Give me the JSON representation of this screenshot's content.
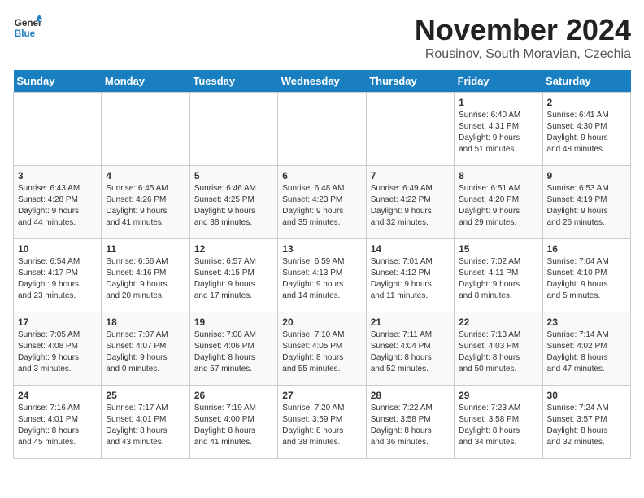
{
  "header": {
    "logo_general": "General",
    "logo_blue": "Blue",
    "month_title": "November 2024",
    "location": "Rousinov, South Moravian, Czechia"
  },
  "weekdays": [
    "Sunday",
    "Monday",
    "Tuesday",
    "Wednesday",
    "Thursday",
    "Friday",
    "Saturday"
  ],
  "weeks": [
    [
      {
        "day": "",
        "info": ""
      },
      {
        "day": "",
        "info": ""
      },
      {
        "day": "",
        "info": ""
      },
      {
        "day": "",
        "info": ""
      },
      {
        "day": "",
        "info": ""
      },
      {
        "day": "1",
        "info": "Sunrise: 6:40 AM\nSunset: 4:31 PM\nDaylight: 9 hours\nand 51 minutes."
      },
      {
        "day": "2",
        "info": "Sunrise: 6:41 AM\nSunset: 4:30 PM\nDaylight: 9 hours\nand 48 minutes."
      }
    ],
    [
      {
        "day": "3",
        "info": "Sunrise: 6:43 AM\nSunset: 4:28 PM\nDaylight: 9 hours\nand 44 minutes."
      },
      {
        "day": "4",
        "info": "Sunrise: 6:45 AM\nSunset: 4:26 PM\nDaylight: 9 hours\nand 41 minutes."
      },
      {
        "day": "5",
        "info": "Sunrise: 6:46 AM\nSunset: 4:25 PM\nDaylight: 9 hours\nand 38 minutes."
      },
      {
        "day": "6",
        "info": "Sunrise: 6:48 AM\nSunset: 4:23 PM\nDaylight: 9 hours\nand 35 minutes."
      },
      {
        "day": "7",
        "info": "Sunrise: 6:49 AM\nSunset: 4:22 PM\nDaylight: 9 hours\nand 32 minutes."
      },
      {
        "day": "8",
        "info": "Sunrise: 6:51 AM\nSunset: 4:20 PM\nDaylight: 9 hours\nand 29 minutes."
      },
      {
        "day": "9",
        "info": "Sunrise: 6:53 AM\nSunset: 4:19 PM\nDaylight: 9 hours\nand 26 minutes."
      }
    ],
    [
      {
        "day": "10",
        "info": "Sunrise: 6:54 AM\nSunset: 4:17 PM\nDaylight: 9 hours\nand 23 minutes."
      },
      {
        "day": "11",
        "info": "Sunrise: 6:56 AM\nSunset: 4:16 PM\nDaylight: 9 hours\nand 20 minutes."
      },
      {
        "day": "12",
        "info": "Sunrise: 6:57 AM\nSunset: 4:15 PM\nDaylight: 9 hours\nand 17 minutes."
      },
      {
        "day": "13",
        "info": "Sunrise: 6:59 AM\nSunset: 4:13 PM\nDaylight: 9 hours\nand 14 minutes."
      },
      {
        "day": "14",
        "info": "Sunrise: 7:01 AM\nSunset: 4:12 PM\nDaylight: 9 hours\nand 11 minutes."
      },
      {
        "day": "15",
        "info": "Sunrise: 7:02 AM\nSunset: 4:11 PM\nDaylight: 9 hours\nand 8 minutes."
      },
      {
        "day": "16",
        "info": "Sunrise: 7:04 AM\nSunset: 4:10 PM\nDaylight: 9 hours\nand 5 minutes."
      }
    ],
    [
      {
        "day": "17",
        "info": "Sunrise: 7:05 AM\nSunset: 4:08 PM\nDaylight: 9 hours\nand 3 minutes."
      },
      {
        "day": "18",
        "info": "Sunrise: 7:07 AM\nSunset: 4:07 PM\nDaylight: 9 hours\nand 0 minutes."
      },
      {
        "day": "19",
        "info": "Sunrise: 7:08 AM\nSunset: 4:06 PM\nDaylight: 8 hours\nand 57 minutes."
      },
      {
        "day": "20",
        "info": "Sunrise: 7:10 AM\nSunset: 4:05 PM\nDaylight: 8 hours\nand 55 minutes."
      },
      {
        "day": "21",
        "info": "Sunrise: 7:11 AM\nSunset: 4:04 PM\nDaylight: 8 hours\nand 52 minutes."
      },
      {
        "day": "22",
        "info": "Sunrise: 7:13 AM\nSunset: 4:03 PM\nDaylight: 8 hours\nand 50 minutes."
      },
      {
        "day": "23",
        "info": "Sunrise: 7:14 AM\nSunset: 4:02 PM\nDaylight: 8 hours\nand 47 minutes."
      }
    ],
    [
      {
        "day": "24",
        "info": "Sunrise: 7:16 AM\nSunset: 4:01 PM\nDaylight: 8 hours\nand 45 minutes."
      },
      {
        "day": "25",
        "info": "Sunrise: 7:17 AM\nSunset: 4:01 PM\nDaylight: 8 hours\nand 43 minutes."
      },
      {
        "day": "26",
        "info": "Sunrise: 7:19 AM\nSunset: 4:00 PM\nDaylight: 8 hours\nand 41 minutes."
      },
      {
        "day": "27",
        "info": "Sunrise: 7:20 AM\nSunset: 3:59 PM\nDaylight: 8 hours\nand 38 minutes."
      },
      {
        "day": "28",
        "info": "Sunrise: 7:22 AM\nSunset: 3:58 PM\nDaylight: 8 hours\nand 36 minutes."
      },
      {
        "day": "29",
        "info": "Sunrise: 7:23 AM\nSunset: 3:58 PM\nDaylight: 8 hours\nand 34 minutes."
      },
      {
        "day": "30",
        "info": "Sunrise: 7:24 AM\nSunset: 3:57 PM\nDaylight: 8 hours\nand 32 minutes."
      }
    ]
  ]
}
